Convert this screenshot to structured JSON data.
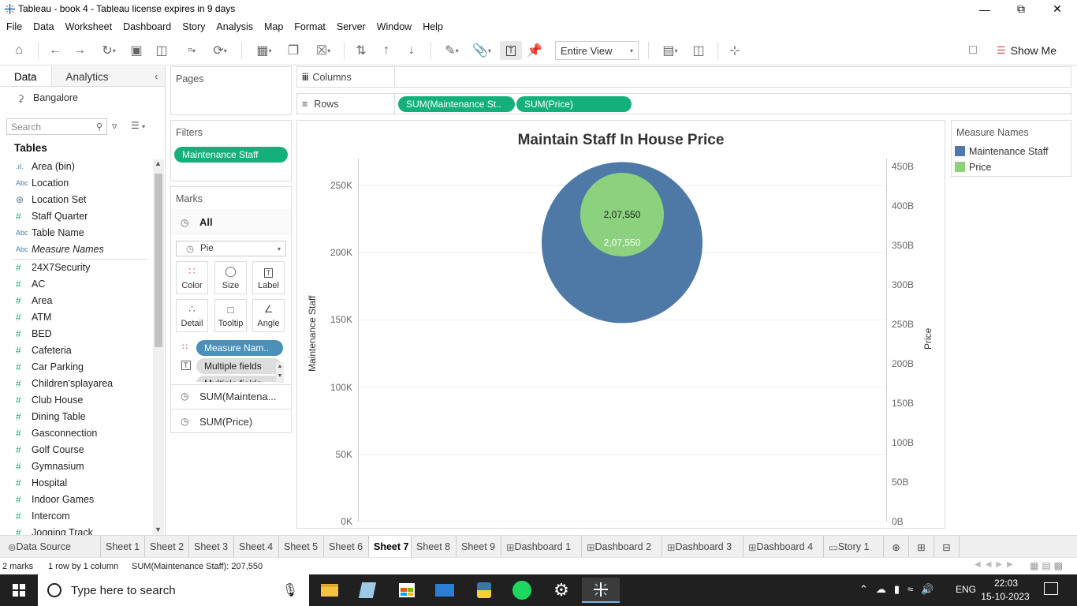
{
  "window": {
    "title": "Tableau - book 4 - Tableau license expires in 9 days"
  },
  "menu": [
    "File",
    "Data",
    "Worksheet",
    "Dashboard",
    "Story",
    "Analysis",
    "Map",
    "Format",
    "Server",
    "Window",
    "Help"
  ],
  "toolbar": {
    "fit_select": "Entire View",
    "show_me": "Show Me"
  },
  "left_pane": {
    "tabs": [
      "Data",
      "Analytics"
    ],
    "datasource": "Bangalore",
    "search_placeholder": "Search",
    "tables_header": "Tables",
    "fields": [
      {
        "type": "bin",
        "name": "Area (bin)",
        "icon": "bar-bin-icon"
      },
      {
        "type": "Abc",
        "name": "Location"
      },
      {
        "type": "set",
        "name": "Location Set"
      },
      {
        "type": "#",
        "name": "Staff Quarter"
      },
      {
        "type": "Abc",
        "name": "Table Name"
      },
      {
        "type": "Abc",
        "name": "Measure Names"
      },
      {
        "type": "#",
        "name": "24X7Security"
      },
      {
        "type": "#",
        "name": "AC"
      },
      {
        "type": "#",
        "name": "Area"
      },
      {
        "type": "#",
        "name": "ATM"
      },
      {
        "type": "#",
        "name": "BED"
      },
      {
        "type": "#",
        "name": "Cafeteria"
      },
      {
        "type": "#",
        "name": "Car Parking"
      },
      {
        "type": "#",
        "name": "Children'splayarea"
      },
      {
        "type": "#",
        "name": "Club House"
      },
      {
        "type": "#",
        "name": "Dining Table"
      },
      {
        "type": "#",
        "name": "Gasconnection"
      },
      {
        "type": "#",
        "name": "Golf Course"
      },
      {
        "type": "#",
        "name": "Gymnasium"
      },
      {
        "type": "#",
        "name": "Hospital"
      },
      {
        "type": "#",
        "name": "Indoor Games"
      },
      {
        "type": "#",
        "name": "Intercom"
      },
      {
        "type": "#",
        "name": "Jogging Track"
      }
    ]
  },
  "shelves": {
    "pages": "Pages",
    "filters": "Filters",
    "filter_pill": "Maintenance Staff",
    "marks": "Marks",
    "marks_all": "All",
    "mark_type": "Pie",
    "mark_buttons": [
      "Color",
      "Size",
      "Label",
      "Detail",
      "Tooltip",
      "Angle"
    ],
    "mark_pills": [
      "Measure Nam..",
      "Multiple fields",
      "Multiple fields"
    ],
    "mark_sections": [
      "SUM(Maintena...",
      "SUM(Price)"
    ],
    "columns": "Columns",
    "rows": "Rows",
    "row_pills": [
      "SUM(Maintenance St..",
      "SUM(Price)"
    ]
  },
  "legend": {
    "title": "Measure Names",
    "items": [
      {
        "label": "Maintenance Staff",
        "color": "#4e79a7"
      },
      {
        "label": "Price",
        "color": "#8cd17d"
      }
    ]
  },
  "chart_data": {
    "type": "pie",
    "title": "Maintain Staff In House Price",
    "ylabel": "Maintenance Staff",
    "y2label": "Price",
    "y_ticks": [
      "0K",
      "50K",
      "100K",
      "150K",
      "200K",
      "250K"
    ],
    "y2_ticks": [
      "0B",
      "50B",
      "100B",
      "150B",
      "200B",
      "250B",
      "300B",
      "350B",
      "400B",
      "450B"
    ],
    "ylim": [
      0,
      270000
    ],
    "y2lim": [
      0,
      460000000000
    ],
    "series": [
      {
        "name": "Maintenance Staff",
        "value": 207550,
        "label": "2,07,550",
        "color": "#4e79a7"
      },
      {
        "name": "Price",
        "value": 207550,
        "label": "2,07,550",
        "color": "#8cd17d"
      }
    ]
  },
  "sheet_tabs": [
    "Data Source",
    "Sheet 1",
    "Sheet 2",
    "Sheet 3",
    "Sheet 4",
    "Sheet 5",
    "Sheet 6",
    "Sheet 7",
    "Sheet 8",
    "Sheet 9",
    "Dashboard 1",
    "Dashboard 2",
    "Dashboard 3",
    "Dashboard 4",
    "Story 1"
  ],
  "active_tab": "Sheet 7",
  "status": {
    "marks": "2 marks",
    "rows": "1 row by 1 column",
    "sum": "SUM(Maintenance Staff): 207,550"
  },
  "taskbar": {
    "search_placeholder": "Type here to search",
    "lang": "ENG",
    "time": "22:03",
    "date": "15-10-2023"
  }
}
